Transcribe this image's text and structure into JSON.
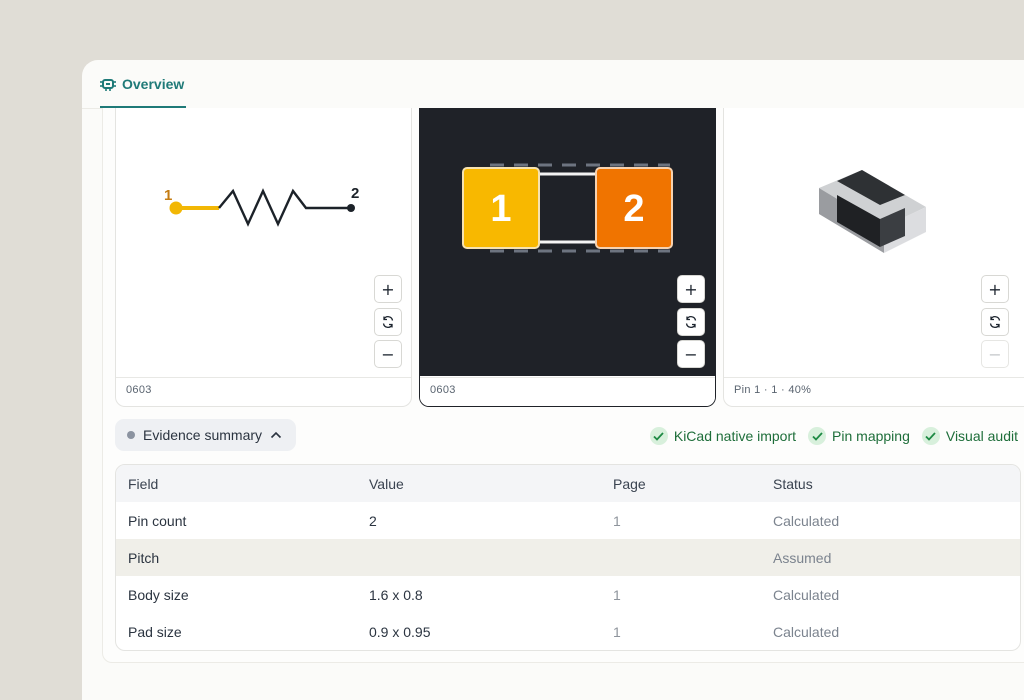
{
  "tab": {
    "label": "Overview"
  },
  "panels": [
    {
      "footer": "0603",
      "pins": [
        "1",
        "2"
      ]
    },
    {
      "footer": "0603",
      "pads": [
        "1",
        "2"
      ]
    },
    {
      "footer": "Pin 1 · 1 · 40%"
    }
  ],
  "controls": {
    "zoom_in": "+",
    "reset": "⟳",
    "zoom_out": "−"
  },
  "evidence": {
    "label": "Evidence summary"
  },
  "checks": [
    "KiCad native import",
    "Pin mapping",
    "Visual audit"
  ],
  "table": {
    "columns": [
      "Field",
      "Value",
      "Page",
      "Status"
    ],
    "rows": [
      {
        "field": "Pin count",
        "value": "2",
        "page": "1",
        "status": "Calculated"
      },
      {
        "field": "Pitch",
        "value": "",
        "page": "",
        "status": "Assumed"
      },
      {
        "field": "Body size",
        "value": "1.6 x 0.8",
        "page": "1",
        "status": "Calculated"
      },
      {
        "field": "Pad size",
        "value": "0.9 x 0.95",
        "page": "1",
        "status": "Calculated"
      }
    ]
  },
  "colors": {
    "accent": "#1f7a78",
    "pad1": "#f8b800",
    "pad2": "#f07400",
    "pcb_bg": "#1f2228",
    "check_green": "#1e8a44"
  }
}
